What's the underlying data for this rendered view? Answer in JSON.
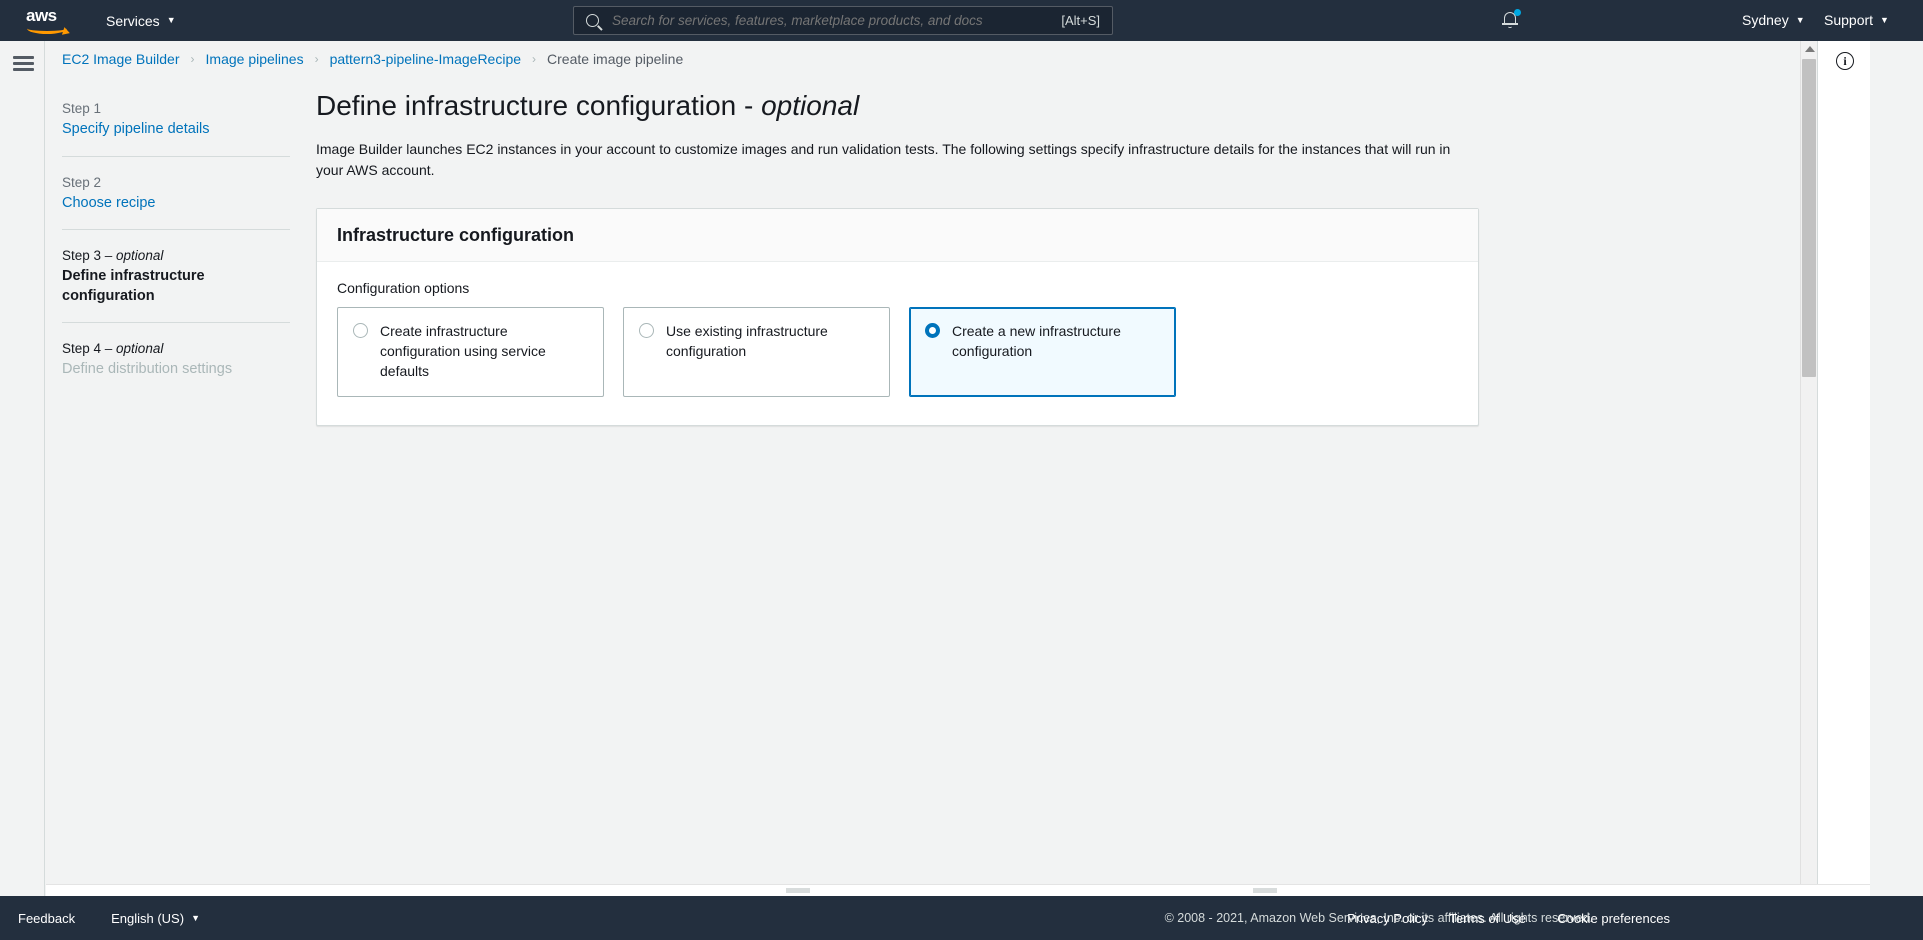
{
  "topnav": {
    "logo_text": "aws",
    "services_label": "Services",
    "search": {
      "placeholder": "Search for services, features, marketplace products, and docs",
      "value": "",
      "shortcut": "[Alt+S]"
    },
    "region_label": "Sydney",
    "support_label": "Support",
    "notification_badge": true,
    "colors": {
      "background": "#232f3e",
      "accent": "#ff9900",
      "badge": "#00a8e1"
    }
  },
  "breadcrumb": {
    "separator": "›",
    "items": [
      {
        "label": "EC2 Image Builder",
        "current": false
      },
      {
        "label": "Image pipelines",
        "current": false
      },
      {
        "label": "pattern3-pipeline-ImageRecipe",
        "current": false
      },
      {
        "label": "Create image pipeline",
        "current": true
      }
    ]
  },
  "steps": [
    {
      "number": "Step 1",
      "optional": "",
      "label": "Specify pipeline details",
      "state": "link"
    },
    {
      "number": "Step 2",
      "optional": "",
      "label": "Choose recipe",
      "state": "link"
    },
    {
      "number": "Step 3",
      "optional": " – optional",
      "label": "Define infrastructure configuration",
      "state": "active"
    },
    {
      "number": "Step 4",
      "optional": " – optional",
      "label": "Define distribution settings",
      "state": "disabled"
    }
  ],
  "main": {
    "title": "Define infrastructure configuration - ",
    "title_optional": "optional",
    "description": "Image Builder launches EC2 instances in your account to customize images and run validation tests. The following settings specify infrastructure details for the instances that will run in your AWS account.",
    "card": {
      "heading": "Infrastructure configuration",
      "field_label": "Configuration options",
      "options": [
        {
          "label": "Create infrastructure configuration using service defaults",
          "selected": false
        },
        {
          "label": "Use existing infrastructure configuration",
          "selected": false
        },
        {
          "label": "Create a new infrastructure configuration",
          "selected": true
        }
      ],
      "selected_color": "#0073bb",
      "selected_background": "#f1faff"
    }
  },
  "right_panel": {
    "info_icon_label": "i"
  },
  "footer": {
    "feedback_label": "Feedback",
    "language_label": "English (US)",
    "copyright": "© 2008 - 2021, Amazon Web Services, Inc. or its affiliates. All rights reserved.",
    "links": [
      {
        "label": "Privacy Policy"
      },
      {
        "label": "Terms of Use"
      },
      {
        "label": "Cookie preferences"
      }
    ]
  }
}
